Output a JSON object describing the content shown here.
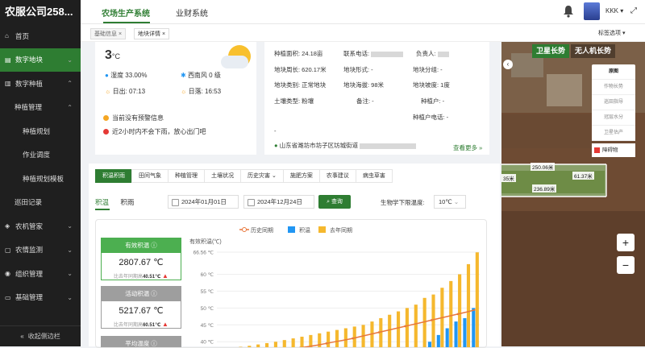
{
  "app": {
    "company": "农服公司258..."
  },
  "sidebar": {
    "items": [
      {
        "label": "首页",
        "icon": "home-icon"
      },
      {
        "label": "数字地块",
        "icon": "map-icon",
        "active": true
      },
      {
        "label": "数字种植",
        "icon": "plant-icon"
      },
      {
        "label": "种植管理"
      },
      {
        "label": "种植规划"
      },
      {
        "label": "作业调度"
      },
      {
        "label": "种植规划模板"
      },
      {
        "label": "巡田记录"
      },
      {
        "label": "农机管家",
        "icon": "tractor-icon"
      },
      {
        "label": "农情监测",
        "icon": "monitor-icon"
      },
      {
        "label": "组织管理",
        "icon": "org-icon"
      },
      {
        "label": "基础管理",
        "icon": "base-icon"
      }
    ],
    "collapse_label": "收起侧边栏"
  },
  "topbar": {
    "systems": [
      "农场生产系统",
      "业财系统"
    ],
    "user": "KKK"
  },
  "tabs": {
    "items": [
      "基础信息",
      "地块详情"
    ],
    "tab_select": "标签选项"
  },
  "weather": {
    "temp": "3",
    "temp_unit": "°C",
    "humidity": "湿度 33.00%",
    "wind": "西南风 0 级",
    "sunrise": "日出: 07:13",
    "sunset": "日落: 16:53",
    "warning": "当前没有预警信息",
    "rain": "近2小时内不会下雨，放心出门吧"
  },
  "plot_info": {
    "area": "种植面积: 24.18亩",
    "contact_phone": "联系电话:",
    "owner": "负责人:",
    "perimeter": "地块周长: 620.17米",
    "shape": "地块形式: -",
    "group": "地块分组: -",
    "category": "地块类别: 正常地块",
    "altitude": "地块海拔: 98米",
    "slope": "地块坡度: 1度",
    "soil": "土壤类型: 粉壤",
    "remark": "备注: -",
    "grower": "种植户: -",
    "grower_phone": "种植户电话: -",
    "dash": "-",
    "address": "山东省潍坊市坊子区坊城街道",
    "more": "查看更多 »"
  },
  "main_tabs": [
    "积温积雨",
    "田间气象",
    "种植管理",
    "土壤状况",
    "历史灾害",
    "施肥方案",
    "农事建议",
    "病虫草害"
  ],
  "sub_tabs": [
    "积温",
    "积雨"
  ],
  "query": {
    "start_date": "2024年01月01日",
    "end_date": "2024年12月24日",
    "query_button": "查询",
    "threshold_label": "生物学下限温度:",
    "threshold_value": "10℃"
  },
  "cards": [
    {
      "title": "有效积温",
      "value": "2807.67 ℃",
      "compare_prefix": "比去年同期高",
      "compare_value": "40.51℃",
      "color": "#4caf50"
    },
    {
      "title": "活动积温",
      "value": "5217.67 ℃",
      "compare_prefix": "比去年同期高",
      "compare_value": "60.51℃",
      "color": "#9e9e9e"
    },
    {
      "title": "平均温度",
      "value": "",
      "compare_prefix": "",
      "compare_value": "",
      "color": "#9e9e9e"
    }
  ],
  "chart_data": {
    "type": "bar",
    "ylabel": "有效积温(℃)",
    "yticks": [
      "66.56 ℃",
      "60 ℃",
      "55 ℃",
      "50 ℃",
      "45 ℃",
      "40 ℃"
    ],
    "ylim": [
      36,
      66.56
    ],
    "legend": [
      "历史同期",
      "积温",
      "去年同期"
    ],
    "legend_colors": [
      "#e8773c",
      "#2196f3",
      "#f5b82e"
    ],
    "series": [
      {
        "name": "积温",
        "values": [
          0,
          0,
          0,
          0,
          0,
          0,
          0,
          0,
          0,
          0,
          0,
          0,
          0,
          0,
          0,
          0,
          0,
          0,
          0,
          0,
          0,
          0,
          0,
          38,
          40,
          42,
          44,
          46,
          47,
          50
        ]
      },
      {
        "name": "去年同期",
        "values": [
          37,
          38,
          38.5,
          38.8,
          39.2,
          39.6,
          40,
          40.5,
          41,
          41.5,
          42,
          42.5,
          43,
          43.5,
          44,
          44.5,
          45,
          46,
          47,
          48,
          49,
          50,
          51,
          53,
          54,
          56,
          58,
          60,
          63,
          66.5
        ]
      },
      {
        "name": "历史同期",
        "values": [
          35,
          35.3,
          35.6,
          36,
          36.3,
          36.7,
          37,
          37.4,
          37.8,
          38.2,
          38.6,
          39,
          39.5,
          40,
          40.5,
          41,
          41.6,
          42.2,
          42.8,
          43.4,
          44,
          44.6,
          45.2,
          45.8,
          46.4,
          47,
          47.6,
          48.2,
          48.8,
          49.5
        ]
      }
    ]
  },
  "map": {
    "tabs": [
      "卫星长势",
      "无人机长势"
    ],
    "layers": [
      "原图",
      "作物长势",
      "巡田指导",
      "冠层水分",
      "卫星估产"
    ],
    "obstacle": "障碍物",
    "labels": [
      "250.06米",
      "61.37米",
      "236.89米",
      "35米"
    ],
    "zoom_in": "+",
    "zoom_out": "−"
  }
}
